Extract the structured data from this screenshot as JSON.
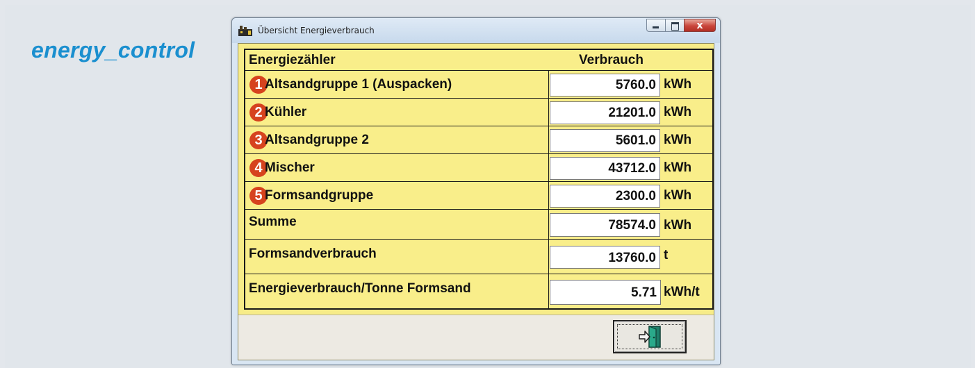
{
  "brand": {
    "text": "energy_control"
  },
  "window": {
    "title": "Übersicht Energieverbrauch",
    "close_glyph": "x"
  },
  "table": {
    "header": {
      "name": "Energiezähler",
      "value": "Verbrauch"
    },
    "rows": [
      {
        "badge": "1",
        "label": "Altsandgruppe 1  (Auspacken)",
        "value": "5760.0",
        "unit": "kWh"
      },
      {
        "badge": "2",
        "label": "Kühler",
        "value": "21201.0",
        "unit": "kWh"
      },
      {
        "badge": "3",
        "label": "Altsandgruppe 2",
        "value": "5601.0",
        "unit": "kWh"
      },
      {
        "badge": "4",
        "label": "Mischer",
        "value": "43712.0",
        "unit": "kWh"
      },
      {
        "badge": "5",
        "label": "Formsandgruppe",
        "value": "2300.0",
        "unit": "kWh"
      },
      {
        "badge": "",
        "label": "Summe",
        "value": "78574.0",
        "unit": "kWh"
      },
      {
        "badge": "",
        "label": "Formsandverbrauch",
        "value": "13760.0",
        "unit": "t"
      },
      {
        "badge": "",
        "label": "Energieverbrauch/Tonne Formsand",
        "value": "5.71",
        "unit": "kWh/t"
      }
    ]
  },
  "icons": {
    "app": "factory-icon",
    "exit": "exit-door-icon",
    "minimize": "minimize-icon",
    "maximize": "maximize-icon",
    "close": "close-icon"
  },
  "colors": {
    "brand": "#1a8fcf",
    "panel": "#f7ec88",
    "badge": "#d6431e",
    "close_button": "#c9453b"
  }
}
